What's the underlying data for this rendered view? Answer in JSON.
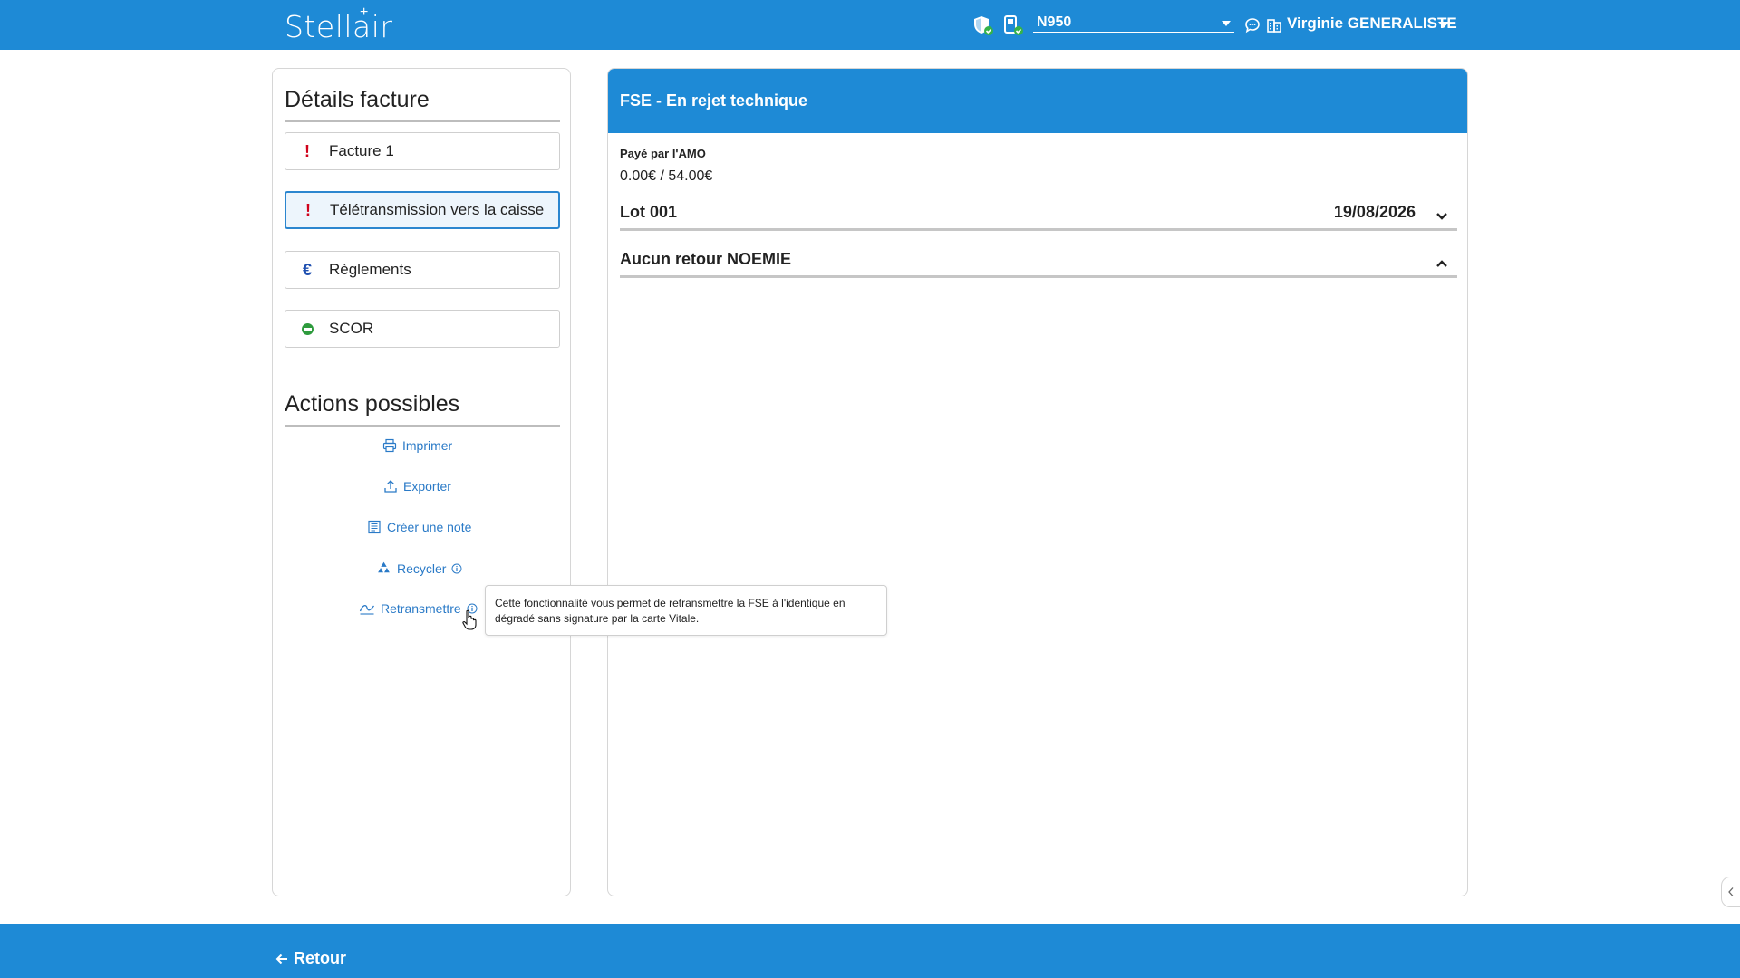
{
  "header": {
    "logo": "Stellair",
    "device_name": "N950",
    "user_name": "Virginie GENERALISTE"
  },
  "left_panel": {
    "details_title": "Détails facture",
    "items": [
      {
        "label": "Facture 1",
        "icon": "exclamation-icon",
        "status_color": "#d0021b"
      },
      {
        "label": "Télétransmission vers la caisse",
        "icon": "exclamation-icon",
        "status_color": "#d0021b",
        "active": true
      },
      {
        "label": "Règlements",
        "icon": "euro-icon",
        "status_color": "#1e4fb0"
      },
      {
        "label": "SCOR",
        "icon": "no-entry-icon",
        "status_color": "#2e9b3d"
      }
    ],
    "actions_title": "Actions possibles",
    "actions": [
      {
        "label": "Imprimer",
        "icon": "printer-icon"
      },
      {
        "label": "Exporter",
        "icon": "upload-icon"
      },
      {
        "label": "Créer une note",
        "icon": "note-icon"
      },
      {
        "label": "Recycler",
        "icon": "recycle-icon",
        "info": true
      },
      {
        "label": "Retransmettre",
        "icon": "signature-icon",
        "info": true
      }
    ],
    "tooltip_text": "Cette fonctionnalité vous permet de retransmettre la FSE à l'identique en dégradé sans signature par la carte Vitale."
  },
  "main": {
    "header_title": "FSE - En rejet technique",
    "paid_label": "Payé par l'AMO",
    "paid_value": "0.00€ / 54.00€",
    "lot_label": "Lot 001",
    "lot_date": "19/08/2026",
    "noemie_label": "Aucun retour NOEMIE"
  },
  "footer": {
    "back_label": "Retour"
  },
  "colors": {
    "primary": "#1e8ad6",
    "link": "#2a7ac7",
    "error": "#d0021b"
  }
}
